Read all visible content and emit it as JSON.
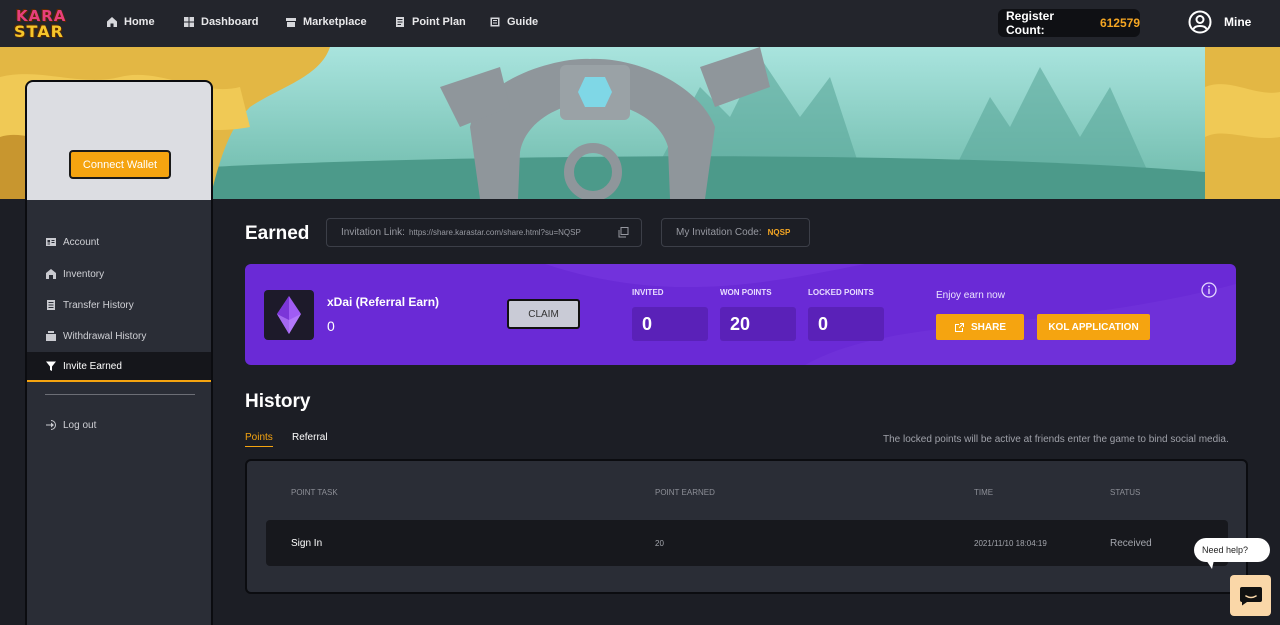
{
  "brand": {
    "logo_line1": "KARA",
    "logo_line2": "STAR"
  },
  "nav": {
    "items": [
      {
        "label": "Home",
        "icon": "home-icon"
      },
      {
        "label": "Dashboard",
        "icon": "dashboard-icon"
      },
      {
        "label": "Marketplace",
        "icon": "marketplace-icon"
      },
      {
        "label": "Point Plan",
        "icon": "point-plan-icon"
      },
      {
        "label": "Guide",
        "icon": "guide-icon"
      }
    ],
    "register_label": "Register Count:",
    "register_count": "612579",
    "user_label": "Mine"
  },
  "sidebar": {
    "connect_wallet": "Connect Wallet",
    "items": [
      {
        "label": "Account",
        "icon": "account-icon"
      },
      {
        "label": "Inventory",
        "icon": "inventory-icon"
      },
      {
        "label": "Transfer History",
        "icon": "transfer-history-icon"
      },
      {
        "label": "Withdrawal History",
        "icon": "withdrawal-history-icon"
      },
      {
        "label": "Invite Earned",
        "icon": "filter-icon",
        "active": true
      }
    ],
    "logout": "Log out"
  },
  "earned": {
    "title": "Earned",
    "invitation_link_label": "Invitation Link:",
    "invitation_link_url": "https://share.karastar.com/share.html?su=NQSP",
    "invitation_code_label": "My Invitation Code:",
    "invitation_code": "NQSP"
  },
  "card": {
    "currency_label": "xDai (Referral Earn)",
    "currency_value": "0",
    "claim_label": "CLAIM",
    "invited_label": "INVITED",
    "invited_value": "0",
    "won_label": "WON POINTS",
    "won_value": "20",
    "locked_label": "LOCKED POINTS",
    "locked_value": "0",
    "enjoy_text": "Enjoy earn now",
    "share_label": "SHARE",
    "kol_label": "KOL APPLICATION",
    "accent_color": "#6a2ad6"
  },
  "history": {
    "title": "History",
    "tabs": [
      "Points",
      "Referral"
    ],
    "active_tab": "Points",
    "note": "The locked points will be active at friends enter the game to bind social media.",
    "columns": [
      "POINT TASK",
      "POINT EARNED",
      "TIME",
      "STATUS"
    ],
    "rows": [
      {
        "task": "Sign In",
        "earned": "20",
        "time": "2021/11/10 18:04:19",
        "status": "Received"
      }
    ]
  },
  "help": {
    "bubble_text": "Need help?"
  },
  "colors": {
    "accent": "#f5a410",
    "background": "#1c1e25",
    "nav": "#23252c"
  }
}
